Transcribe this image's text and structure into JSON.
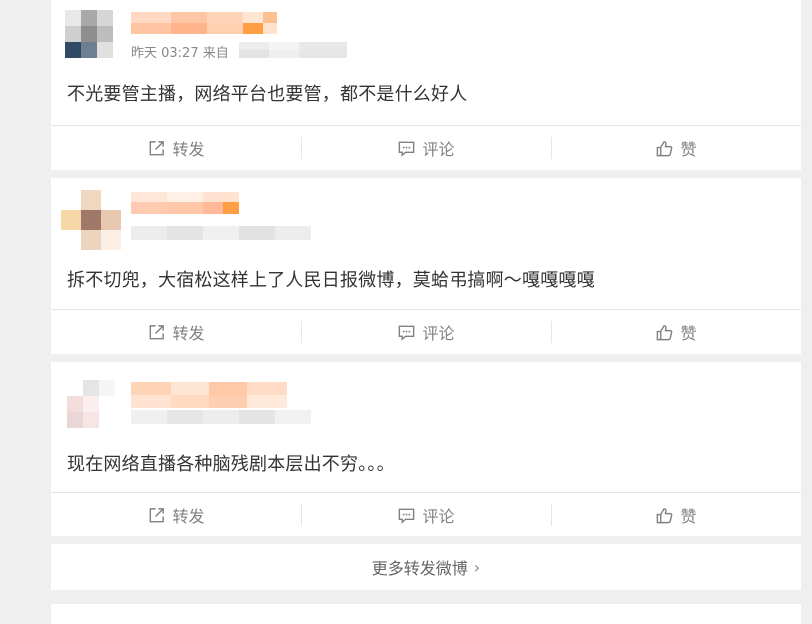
{
  "posts": [
    {
      "meta_visible": "昨天 03:27 来自",
      "text": "不光要管主播，网络平台也要管，都不是什么好人",
      "actions": {
        "repost": "转发",
        "comment": "评论",
        "like": "赞"
      }
    },
    {
      "meta_visible": "",
      "text": "拆不切兜，大宿松这样上了人民日报微博，莫蛤弔搞啊～嘎嘎嘎嘎",
      "actions": {
        "repost": "转发",
        "comment": "评论",
        "like": "赞"
      }
    },
    {
      "meta_visible": "",
      "text": "现在网络直播各种脑残剧本层出不穷。。。",
      "actions": {
        "repost": "转发",
        "comment": "评论",
        "like": "赞"
      }
    }
  ],
  "more_link": "更多转发微博",
  "colors": {
    "accent_orange": "#ff9f43",
    "pixel_orange": "#ffb37a",
    "text": "#333333",
    "muted": "#808080",
    "divider": "#e6e6e6"
  }
}
